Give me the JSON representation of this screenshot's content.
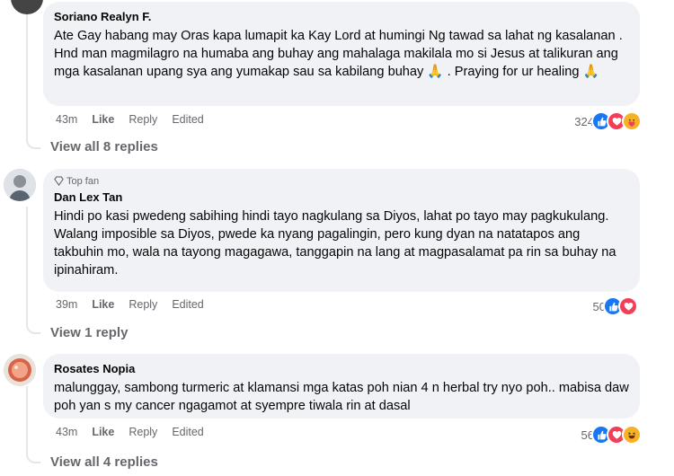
{
  "comments": [
    {
      "author": "Soriano Realyn F.",
      "text": "Ate Gay habang may Oras kapa lumapit ka Kay Lord at humingi Ng tawad sa lahat ng kasalanan . Hnd man magmilagro na humaba ang buhay ang mahalaga makilala mo si Jesus at talikuran ang mga kasalanan upang sya ang yumakap sau sa kabilang buhay 🙏 . Praying for ur healing 🙏",
      "time": "43m",
      "like": "Like",
      "reply": "Reply",
      "edited": "Edited",
      "reaction_count": "324",
      "reactions": [
        "like-icon",
        "love-icon",
        "care-icon"
      ],
      "view_replies": "View all 8 replies"
    },
    {
      "badge": "Top fan",
      "author": "Dan Lex Tan",
      "text": "Hindi po kasi pwedeng sabihing hindi tayo nagkulang sa Diyos, lahat po tayo may pagkukulang. Walang imposible sa Diyos, pwede ka nyang pagalingin, pero kung dyan na natatapos ang takbuhin mo, wala na tayong magagawa, tanggapin na lang at magpasalamat pa rin sa buhay na ipinahiram.",
      "time": "39m",
      "like": "Like",
      "reply": "Reply",
      "edited": "Edited",
      "reaction_count": "50",
      "reactions": [
        "like-icon",
        "love-icon"
      ],
      "view_replies": "View 1 reply"
    },
    {
      "author": "Rosates Nopia",
      "text": "malunggay, sambong turmeric at klamansi mga katas poh nian 4 n herbal try nyo poh.. mabisa daw poh yan s my cancer ngagamot at syempre tiwala rin at dasal",
      "time": "43m",
      "like": "Like",
      "reply": "Reply",
      "edited": "Edited",
      "reaction_count": "56",
      "reactions": [
        "like-icon",
        "love-icon",
        "haha-icon"
      ],
      "view_replies": "View all 4 replies"
    }
  ],
  "colors": {
    "bubble": "#f0f2f5",
    "meta": "#65676b",
    "like_blue": "#1877f2",
    "love_red": "#f33e58",
    "emoji_yellow": "#f7b125"
  }
}
